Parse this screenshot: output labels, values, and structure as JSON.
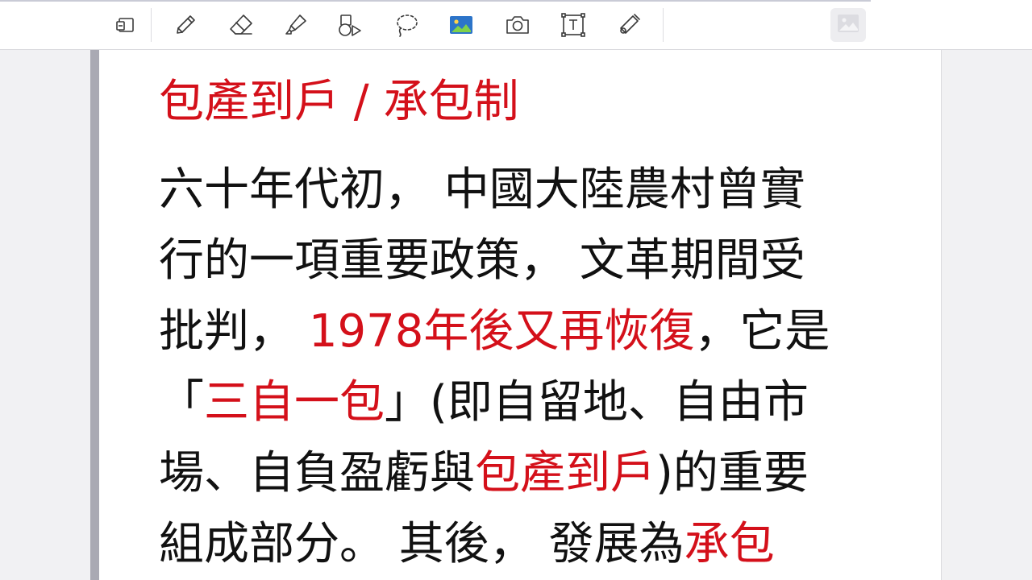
{
  "toolbar": {
    "tools": [
      {
        "id": "page-layout",
        "icon": "page-layout-icon"
      },
      {
        "id": "pen",
        "icon": "pen-icon"
      },
      {
        "id": "eraser",
        "icon": "eraser-icon"
      },
      {
        "id": "highlighter",
        "icon": "highlighter-icon"
      },
      {
        "id": "shapes",
        "icon": "shapes-icon"
      },
      {
        "id": "lasso",
        "icon": "lasso-icon"
      },
      {
        "id": "image",
        "icon": "image-icon"
      },
      {
        "id": "camera",
        "icon": "camera-icon"
      },
      {
        "id": "text",
        "icon": "text-box-icon"
      },
      {
        "id": "laser-pointer",
        "icon": "laser-pointer-icon"
      }
    ],
    "accent_color": "#2c74c9",
    "thumbnail_icon": "image-placeholder-icon"
  },
  "note": {
    "title": "包產到戶 / 承包制",
    "highlight_color": "#d4101a",
    "lines": [
      [
        {
          "t": "六十年代初， 中國大陸農村曾實",
          "hl": false
        }
      ],
      [
        {
          "t": "行的一項重要政策， 文革期間受",
          "hl": false
        }
      ],
      [
        {
          "t": "批判， ",
          "hl": false
        },
        {
          "t": "1978年後又再恢復",
          "hl": true
        },
        {
          "t": "，它是",
          "hl": false
        }
      ],
      [
        {
          "t": "「",
          "hl": false
        },
        {
          "t": "三自一包",
          "hl": true
        },
        {
          "t": "」(即自留地、自由市",
          "hl": false
        }
      ],
      [
        {
          "t": "場、自負盈虧與",
          "hl": false
        },
        {
          "t": "包產到戶",
          "hl": true
        },
        {
          "t": ")的重要",
          "hl": false
        }
      ],
      [
        {
          "t": "組成部分。 其後， 發展為",
          "hl": false
        },
        {
          "t": "承包",
          "hl": true
        }
      ]
    ]
  }
}
